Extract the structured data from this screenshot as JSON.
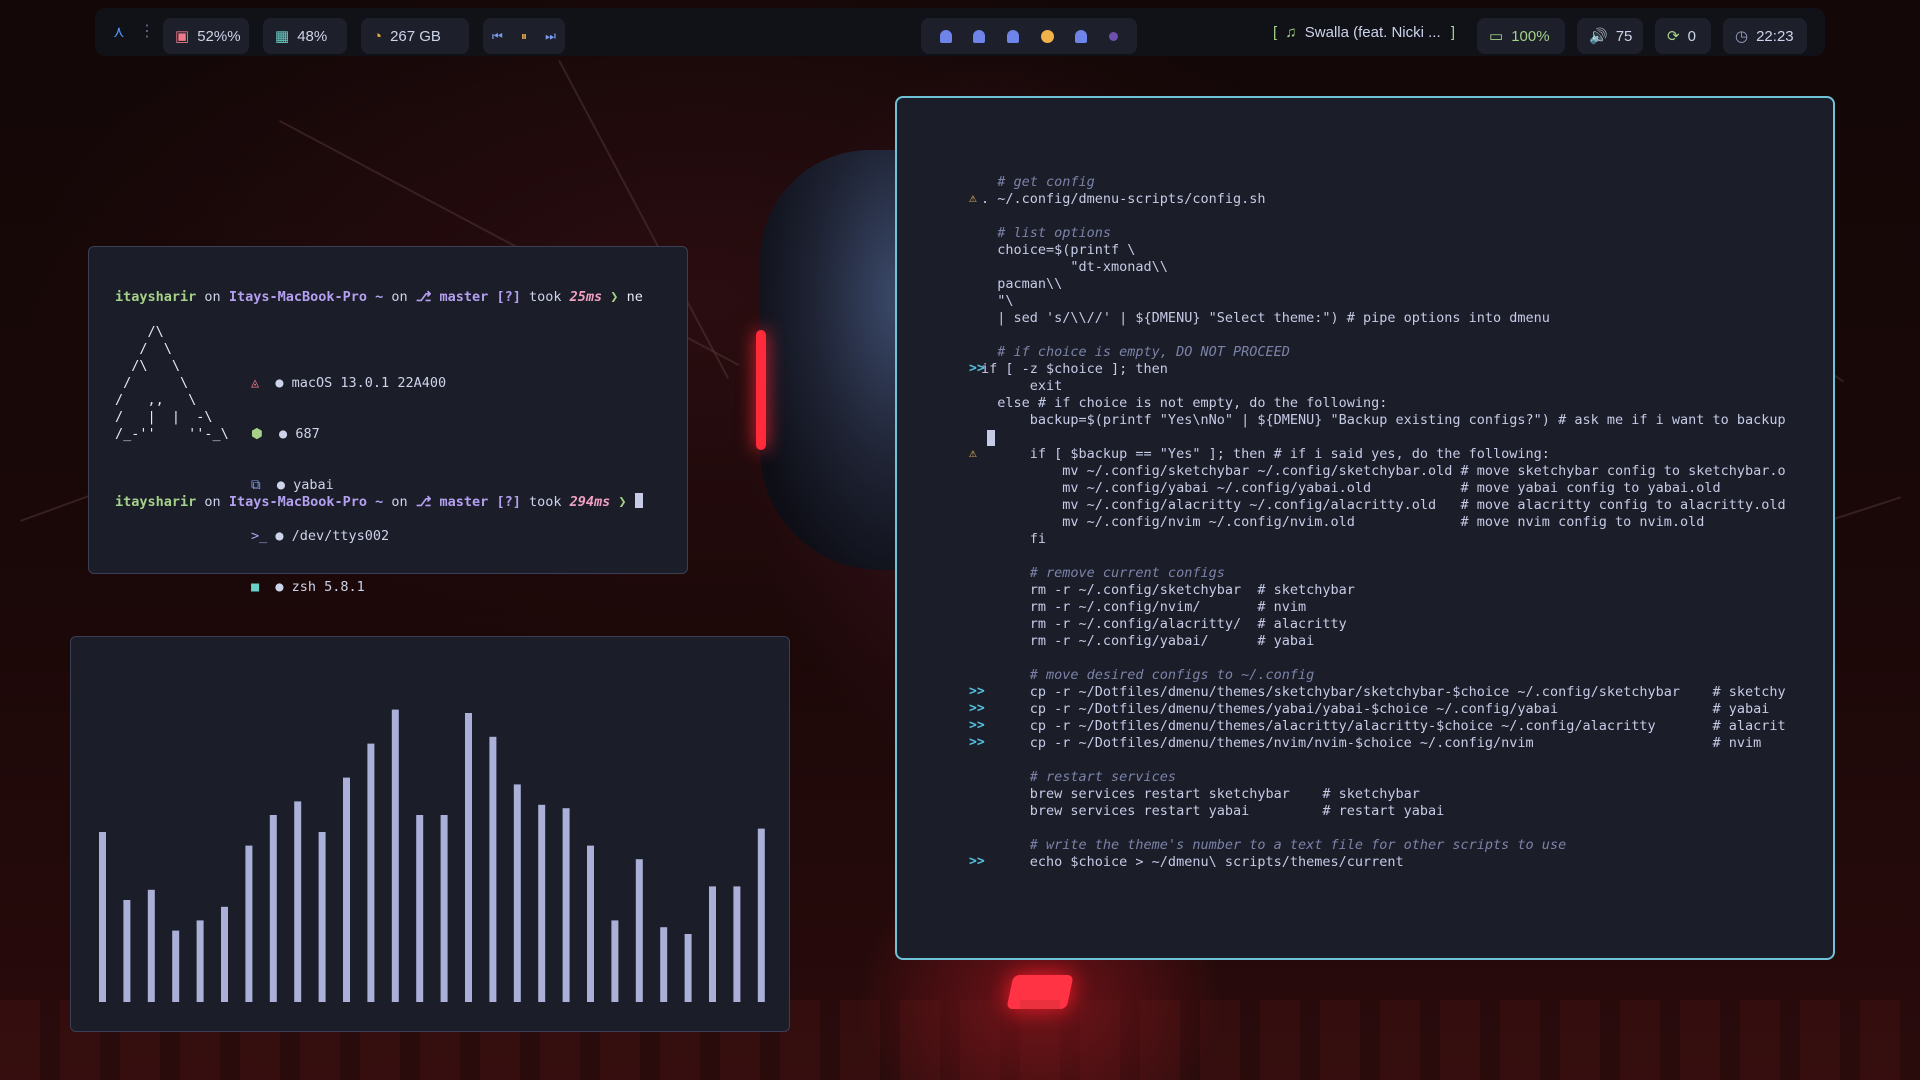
{
  "topbar": {
    "cpu": {
      "icon": "cpu-icon",
      "value": "52%%"
    },
    "memory": {
      "icon": "memory-icon",
      "value": "48%"
    },
    "disk": {
      "icon": "disk-icon",
      "value": "267 GB"
    },
    "media_controls": [
      "previous-icon",
      "pause-icon",
      "next-icon"
    ],
    "music": {
      "prefix": "[",
      "icon": "music-note-icon",
      "title": "Swalla (feat. Nicki ...",
      "suffix": "]"
    },
    "battery": {
      "icon": "battery-icon",
      "value": "100%"
    },
    "volume": {
      "icon": "volume-icon",
      "value": "75"
    },
    "updates": {
      "icon": "refresh-icon",
      "value": "0"
    },
    "clock": {
      "icon": "clock-icon",
      "value": "22:23"
    }
  },
  "terminal": {
    "prompt1": {
      "user": "itaysharir",
      "on": "on",
      "host": "Itays-MacBook-Pro",
      "path": "~",
      "on2": "on",
      "branch": "master",
      "status": "[?]",
      "took": "took",
      "time": "25ms",
      "arrow": "❯",
      "command": "ne"
    },
    "ascii": [
      "    /\\",
      "   /  \\",
      "  /\\   \\",
      " /      \\",
      "/   ,,   \\",
      "/   |  |  -\\",
      "/_-''    ''-_\\"
    ],
    "info": [
      {
        "icon": "os-icon",
        "text": "macOS 13.0.1 22A400"
      },
      {
        "icon": "package-icon",
        "text": "687"
      },
      {
        "icon": "window-manager-icon",
        "text": "yabai"
      },
      {
        "icon": "terminal-icon",
        "text": "/dev/ttys002"
      },
      {
        "icon": "shell-icon",
        "text": "zsh 5.8.1"
      }
    ],
    "prompt2": {
      "user": "itaysharir",
      "on": "on",
      "host": "Itays-MacBook-Pro",
      "path": "~",
      "on2": "on",
      "branch": "master",
      "status": "[?]",
      "took": "took",
      "time": "294ms",
      "arrow": "❯"
    }
  },
  "visualizer": {
    "bar_color": "#aab0d8",
    "levels": [
      0.5,
      0.3,
      0.33,
      0.21,
      0.24,
      0.28,
      0.46,
      0.55,
      0.59,
      0.5,
      0.66,
      0.76,
      0.86,
      0.55,
      0.55,
      0.85,
      0.78,
      0.64,
      0.58,
      0.57,
      0.46,
      0.24,
      0.42,
      0.22,
      0.2,
      0.34,
      0.34,
      0.51
    ]
  },
  "editor": {
    "lines": [
      "  # get config",
      ". ~/.config/dmenu-scripts/config.sh",
      "",
      "  # list options",
      "  choice=$(printf \\",
      "           \"dt-xmonad\\\\",
      "  pacman\\\\",
      "  \"\\",
      "  | sed 's/\\\\//' | ${DMENU} \"Select theme:\") # pipe options into dmenu",
      "",
      "  # if choice is empty, DO NOT PROCEED",
      "if [ -z $choice ]; then",
      "      exit",
      "  else # if choice is not empty, do the following:",
      "      backup=$(printf \"Yes\\nNo\" | ${DMENU} \"Backup existing configs?\") # ask me if i want to backup",
      "",
      "      if [ $backup == \"Yes\" ]; then # if i said yes, do the following:",
      "          mv ~/.config/sketchybar ~/.config/sketchybar.old # move sketchybar config to sketchybar.o",
      "          mv ~/.config/yabai ~/.config/yabai.old           # move yabai config to yabai.old",
      "          mv ~/.config/alacritty ~/.config/alacritty.old   # move alacritty config to alacritty.old",
      "          mv ~/.config/nvim ~/.config/nvim.old             # move nvim config to nvim.old",
      "      fi",
      "",
      "      # remove current configs",
      "      rm -r ~/.config/sketchybar  # sketchybar",
      "      rm -r ~/.config/nvim/       # nvim",
      "      rm -r ~/.config/alacritty/  # alacritty",
      "      rm -r ~/.config/yabai/      # yabai",
      "",
      "      # move desired configs to ~/.config",
      "      cp -r ~/Dotfiles/dmenu/themes/sketchybar/sketchybar-$choice ~/.config/sketchybar    # sketchy",
      "      cp -r ~/Dotfiles/dmenu/themes/yabai/yabai-$choice ~/.config/yabai                   # yabai",
      "      cp -r ~/Dotfiles/dmenu/themes/alacritty/alacritty-$choice ~/.config/alacritty       # alacrit",
      "      cp -r ~/Dotfiles/dmenu/themes/nvim/nvim-$choice ~/.config/nvim                      # nvim",
      "",
      "      # restart services",
      "      brew services restart sketchybar    # sketchybar",
      "      brew services restart yabai         # restart yabai",
      "",
      "      # write the theme's number to a text file for other scripts to use",
      "      echo $choice > ~/dmenu\\ scripts/themes/current"
    ],
    "signs": {
      "warn_lines": [
        1,
        16
      ],
      "diff_lines": [
        11,
        30,
        31,
        32,
        33,
        40
      ],
      "diff_mark": ">>",
      "warn_mark": "⚠"
    }
  }
}
